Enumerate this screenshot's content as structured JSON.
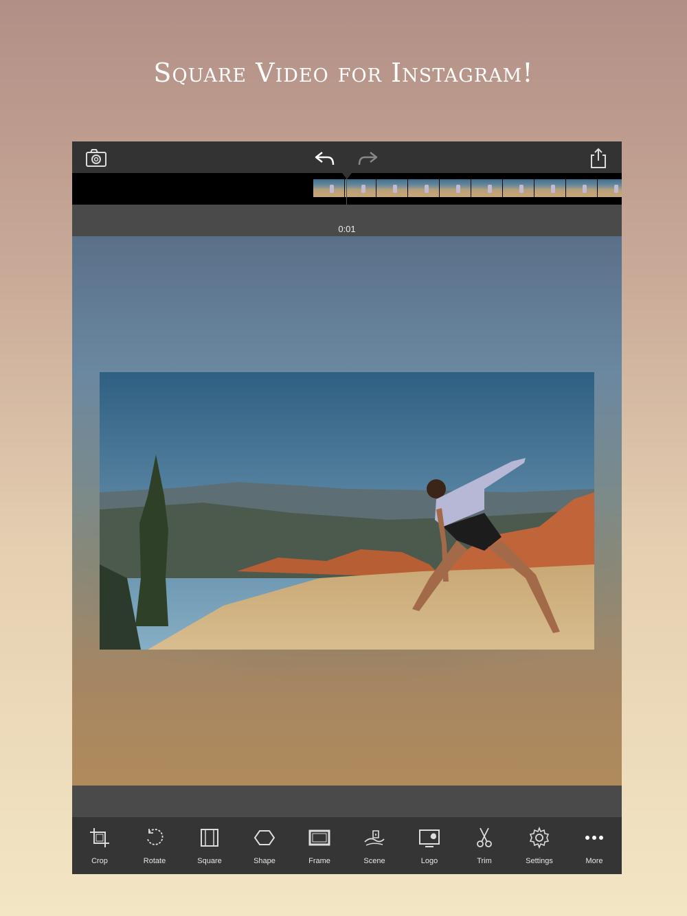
{
  "headline": "Square Video for Instagram!",
  "time_label": "0:01",
  "toolbar": [
    {
      "label": "Crop",
      "icon": "crop-icon"
    },
    {
      "label": "Rotate",
      "icon": "rotate-icon"
    },
    {
      "label": "Square",
      "icon": "square-icon"
    },
    {
      "label": "Shape",
      "icon": "shape-icon"
    },
    {
      "label": "Frame",
      "icon": "frame-icon"
    },
    {
      "label": "Scene",
      "icon": "scene-icon"
    },
    {
      "label": "Logo",
      "icon": "logo-icon"
    },
    {
      "label": "Trim",
      "icon": "scissors-icon"
    },
    {
      "label": "Settings",
      "icon": "gear-icon"
    },
    {
      "label": "More",
      "icon": "more-icon"
    }
  ],
  "colors": {
    "accent_text": "#ffffff",
    "toolbar_bg": "#353535"
  }
}
